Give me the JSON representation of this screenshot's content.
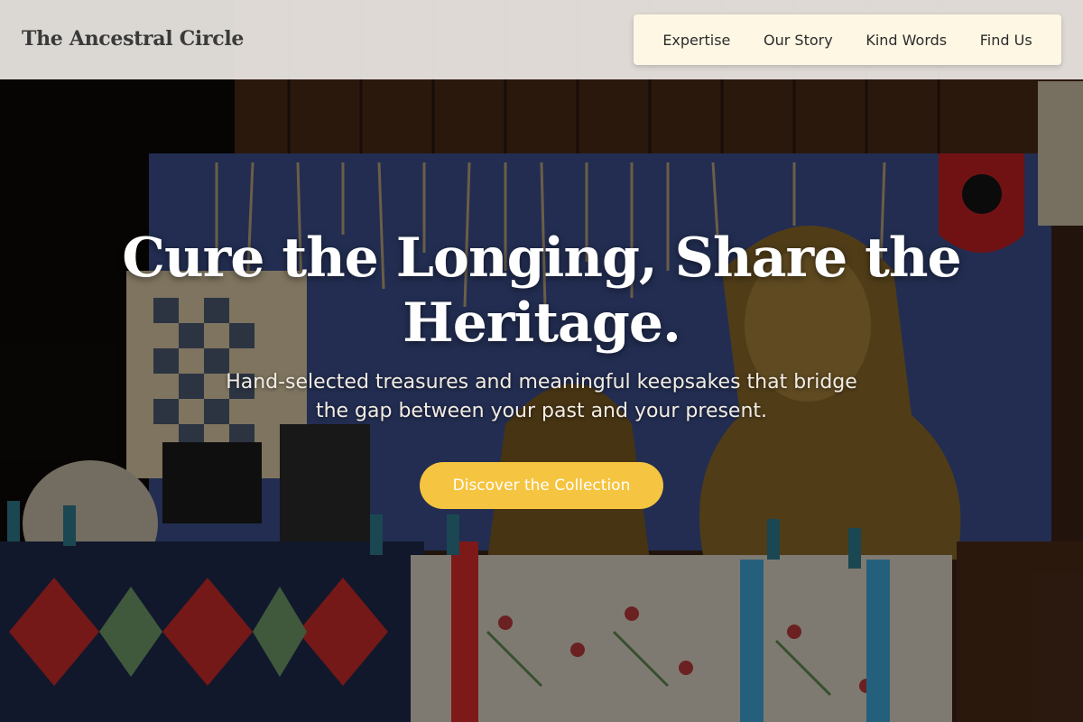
{
  "header": {
    "brand": "The Ancestral Circle",
    "nav": [
      {
        "label": "Expertise"
      },
      {
        "label": "Our Story"
      },
      {
        "label": "Kind Words"
      },
      {
        "label": "Find Us"
      }
    ]
  },
  "hero": {
    "title": "Cure the Longing, Share the Heritage.",
    "subtitle": "Hand-selected treasures and meaningful keepsakes that bridge the gap between your past and your present.",
    "cta_label": "Discover the Collection"
  },
  "colors": {
    "accent": "#f5c440",
    "nav_background": "#fdf7e3",
    "header_background": "#ece8e4"
  }
}
